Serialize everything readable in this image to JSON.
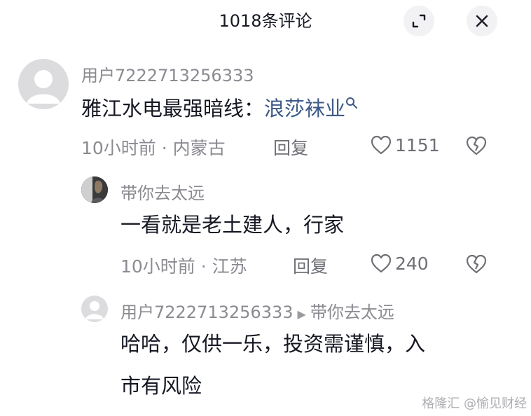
{
  "header": {
    "title": "1018条评论"
  },
  "comments": [
    {
      "user": "用户7222713256333",
      "text_prefix": "雅江水电最强暗线：",
      "text_link": "浪莎袜业",
      "time": "10小时前",
      "location": "内蒙古",
      "reply_label": "回复",
      "likes": "1151"
    },
    {
      "user": "带你去太远",
      "text": "一看就是老土建人，行家",
      "time": "10小时前",
      "location": "江苏",
      "reply_label": "回复",
      "likes": "240"
    },
    {
      "user": "用户7222713256333",
      "reply_to": "带你去太远",
      "text_line1": "哈哈，仅供一乐，投资需谨慎，入",
      "text_line2": "市有风险"
    }
  ],
  "watermark": "格隆汇 @愉见财经",
  "icons": {
    "collapse": "collapse-icon",
    "close": "close-icon",
    "search": "search-icon",
    "like": "heart-icon",
    "dislike": "broken-heart-icon"
  }
}
